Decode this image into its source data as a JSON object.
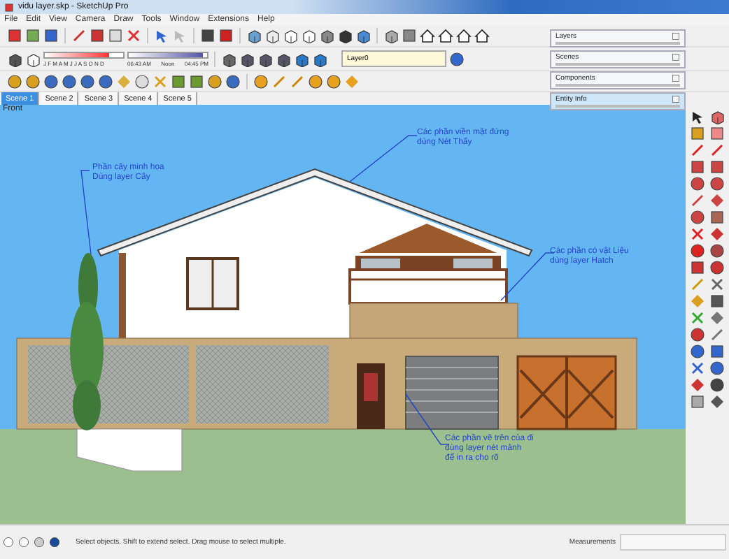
{
  "window": {
    "title": "vidu layer.skp - SketchUp Pro"
  },
  "menu": [
    "File",
    "Edit",
    "View",
    "Camera",
    "Draw",
    "Tools",
    "Window",
    "Extensions",
    "Help"
  ],
  "shadow_settings": {
    "month_slider": {
      "level": 0.82
    },
    "months": "J F M A M J J A S O N D",
    "time_slider": {
      "level": 0.95
    },
    "start_time": "06:43 AM",
    "noon": "Noon",
    "end_time": "04:45 PM"
  },
  "layer_select": {
    "value": "Layer0"
  },
  "scene_tabs": [
    {
      "label": "Scene 1",
      "selected": true
    },
    {
      "label": "Scene 2",
      "selected": false
    },
    {
      "label": "Scene 3",
      "selected": false
    },
    {
      "label": "Scene 4",
      "selected": false
    },
    {
      "label": "Scene 5",
      "selected": false
    }
  ],
  "tray_panels": [
    {
      "title": "Layers",
      "selected": false
    },
    {
      "title": "Scenes",
      "selected": false
    },
    {
      "title": "Components",
      "selected": false
    },
    {
      "title": "Entity Info",
      "selected": true
    }
  ],
  "viewport": {
    "view_label": "Front",
    "annotations": [
      {
        "lines": [
          "Phần cây minh họa",
          "Dùng layer Cây"
        ]
      },
      {
        "lines": [
          "Các phần viền mặt đứng",
          "dùng Nét Thấy"
        ]
      },
      {
        "lines": [
          "Các phần có vật Liệu",
          "dùng layer Hatch"
        ]
      },
      {
        "lines": [
          "Các phần vẽ trên của đi",
          "dùng layer nét mảnh",
          "để in ra cho rõ"
        ]
      }
    ]
  },
  "status_bar": {
    "message": "Select objects. Shift to extend select. Drag mouse to select multiple.",
    "measurements_label": "Measurements"
  }
}
